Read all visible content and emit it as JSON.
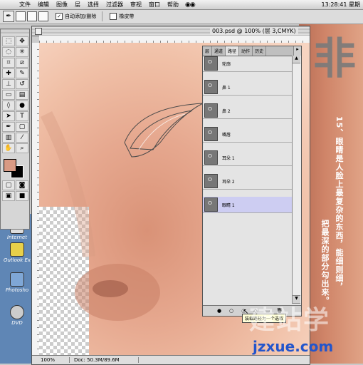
{
  "menubar": {
    "apple": "",
    "items": [
      "文件",
      "编辑",
      "图像",
      "层",
      "选择",
      "过滤器",
      "审视",
      "窗口",
      "帮助"
    ],
    "clock": "13:28:41 星期"
  },
  "options": {
    "auto_add_delete": "自动添加/删除",
    "rubber_band": "橡皮带"
  },
  "document": {
    "title": "003.psd @ 100% (层 3,CMYK)",
    "zoom": "100%",
    "doc_size": "Doc: 50.3M/89.6M"
  },
  "paths_panel": {
    "tabs": [
      "层",
      "通道",
      "路径",
      "动作",
      "历史"
    ],
    "active_tab": "路径",
    "paths": [
      {
        "name": "轮廓",
        "selected": false
      },
      {
        "name": "鼻 1",
        "selected": false
      },
      {
        "name": "鼻 2",
        "selected": false
      },
      {
        "name": "嘴唇",
        "selected": false
      },
      {
        "name": "耳朵 1",
        "selected": false
      },
      {
        "name": "耳朵 2",
        "selected": false
      },
      {
        "name": "眼睛 1",
        "selected": true
      }
    ],
    "tooltip": "装载路径为一个选取"
  },
  "desktop": {
    "icons": [
      "Internet",
      "Outlook Ex",
      "Photosho",
      "DVD"
    ]
  },
  "right_page": {
    "big_char": "非",
    "text_line1": "15、眼睛是人脸上最复杂的东西，能细则细，",
    "text_line2": "把最深的部分勾出来。"
  },
  "watermark": {
    "main": "建站学",
    "url": "jzxue.com"
  },
  "colors": {
    "foreground": "#d99a84",
    "background": "#000000",
    "selected_row": "#cdcdf2"
  }
}
